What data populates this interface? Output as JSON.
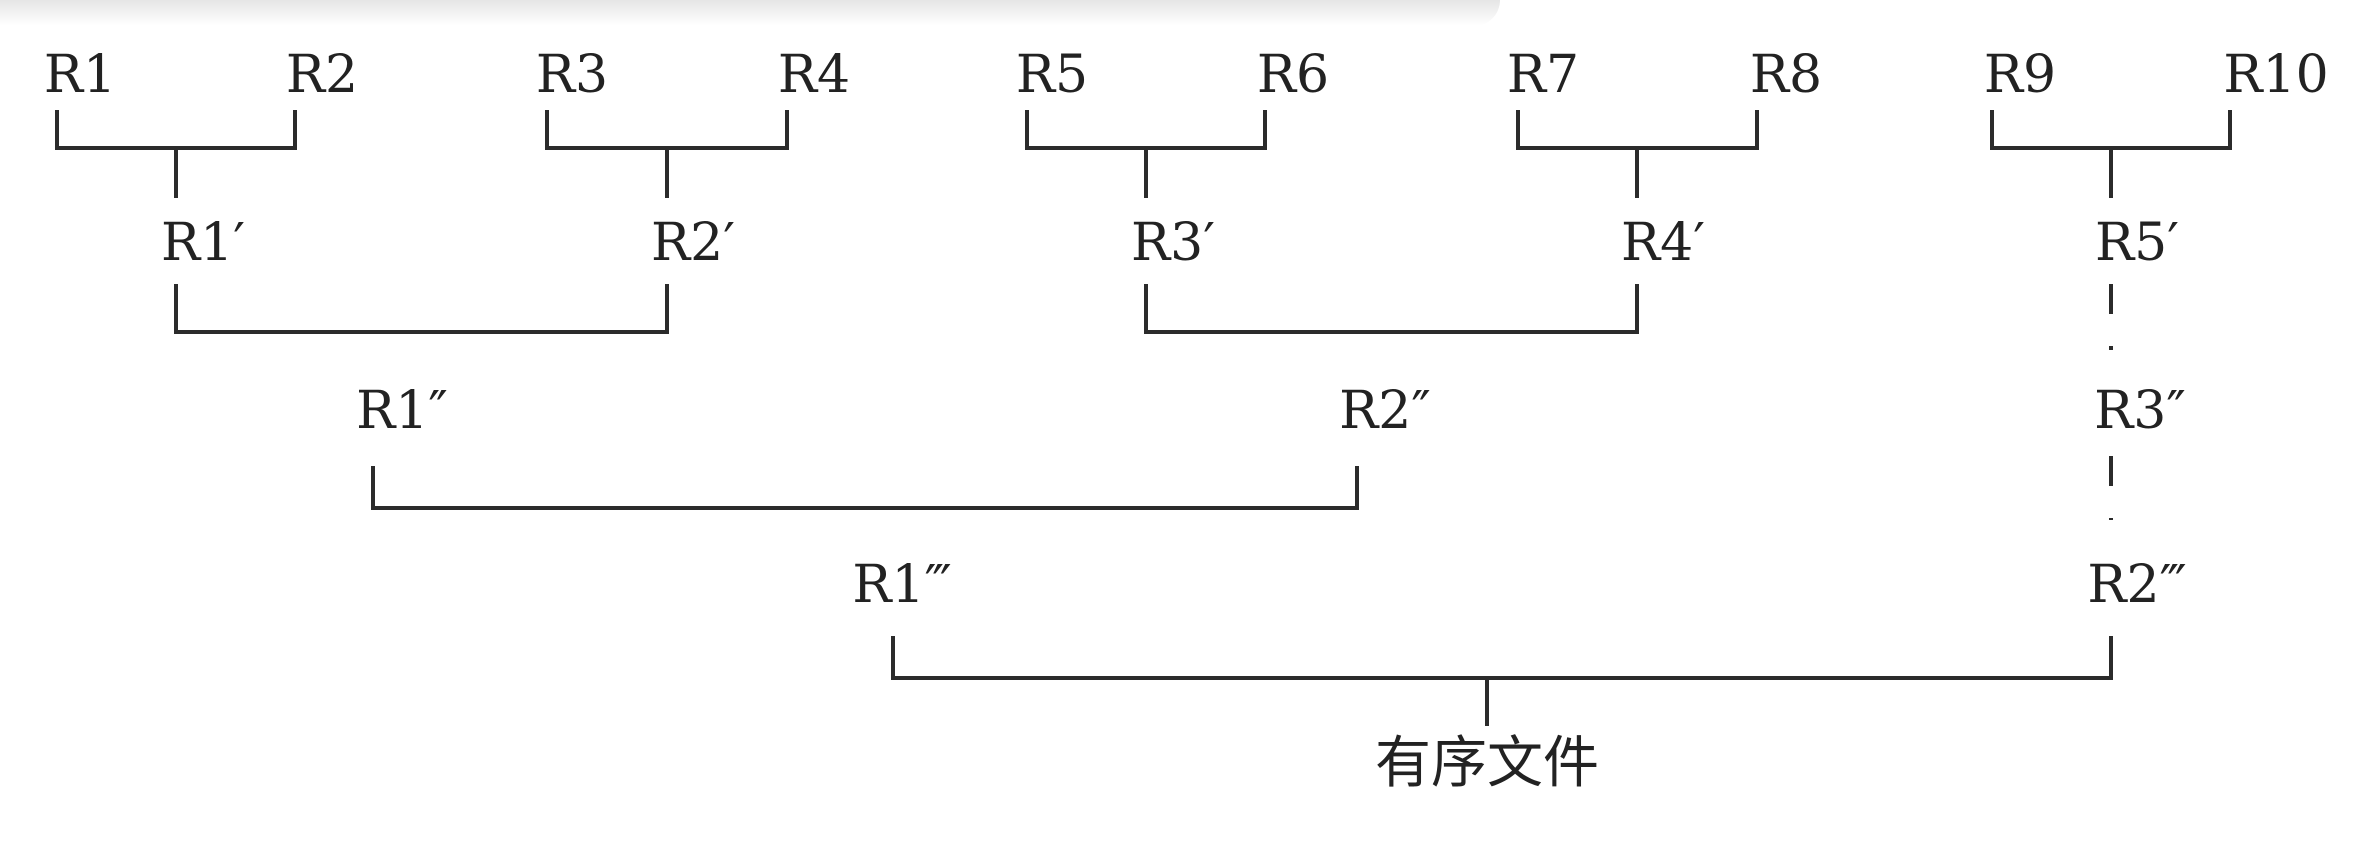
{
  "diagram": {
    "level0": [
      "R1",
      "R2",
      "R3",
      "R4",
      "R5",
      "R6",
      "R7",
      "R8",
      "R9",
      "R10"
    ],
    "level1": [
      "R1′",
      "R2′",
      "R3′",
      "R4′",
      "R5′"
    ],
    "level2": [
      "R1″",
      "R2″",
      "R3″"
    ],
    "level3": [
      "R1‴",
      "R2‴"
    ],
    "final": "有序文件"
  }
}
